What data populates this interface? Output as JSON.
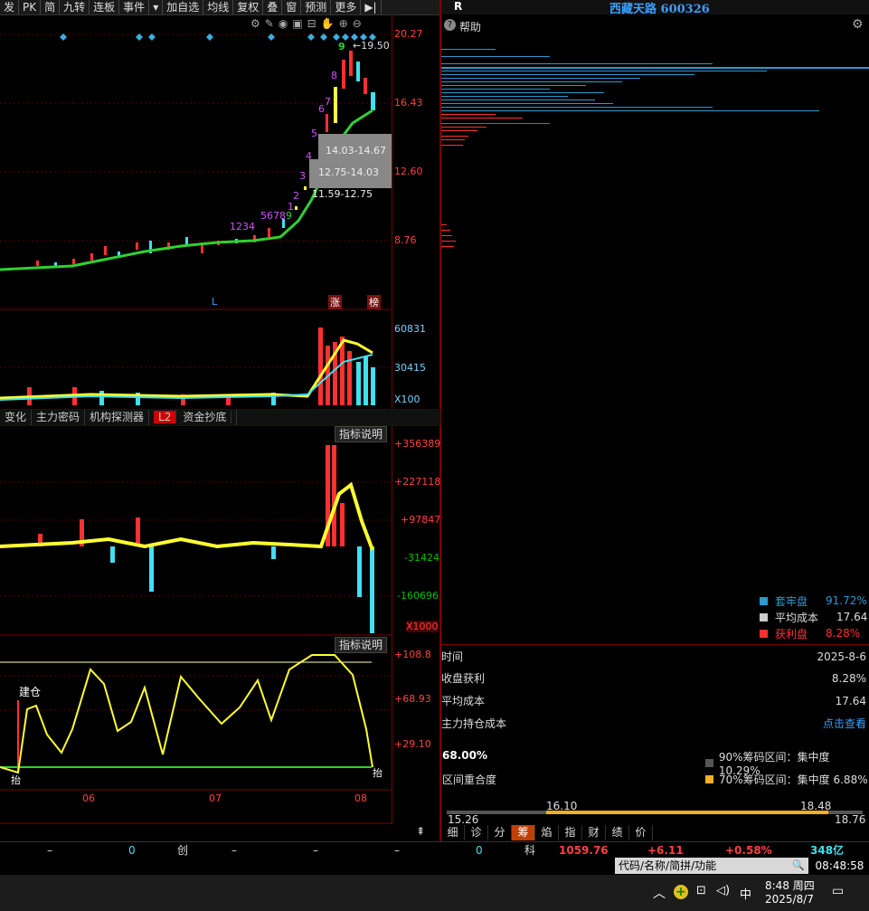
{
  "toolbar": {
    "items": [
      "发",
      "PK",
      "简",
      "九转",
      "连板",
      "事件",
      "▾",
      "加自选",
      "均线",
      "复权",
      "叠",
      "窗",
      "预测",
      "更多",
      "▶|"
    ]
  },
  "header": {
    "r_label": "R",
    "stock_name": "西藏天路 600326",
    "help": "帮助"
  },
  "price_axis": [
    "20.27",
    "16.43",
    "12.60",
    "8.76"
  ],
  "price_annotations": {
    "high": "19.50",
    "box1": "14.03-14.67",
    "box2": "12.75-14.03",
    "box3": "11.59-12.75",
    "zhang": "涨",
    "bang": "榜",
    "l_mark": "L"
  },
  "nine_turn": {
    "labels": [
      "1",
      "2",
      "3",
      "4",
      "5",
      "6",
      "7",
      "8",
      "9",
      "1",
      "2",
      "3",
      "4",
      "5",
      "6",
      "7",
      "8",
      "9"
    ]
  },
  "volume_axis": [
    "60831",
    "30415",
    "X100"
  ],
  "tabs": [
    "变化",
    "主力密码",
    "机构探测器",
    "L2",
    "资金抄底"
  ],
  "indicator1": {
    "desc_label": "指标说明",
    "axis": [
      "+356389",
      "+227118",
      "+97847",
      "-31424",
      "-160696",
      "X1000"
    ]
  },
  "indicator2": {
    "desc_label": "指标说明",
    "axis": [
      "+108.8",
      "+68.93",
      "+29.10"
    ],
    "build": "建仓",
    "di": "抬",
    "di2": "抬"
  },
  "x_axis": [
    "06",
    "07",
    "08"
  ],
  "chip": {
    "legend": [
      {
        "label": "套牢盘",
        "value": "91.72%",
        "color": "#2a9ad0"
      },
      {
        "label": "平均成本",
        "value": "17.64",
        "color": "#cccccc"
      },
      {
        "label": "获利盘",
        "value": "8.28%",
        "color": "#ff3030"
      }
    ],
    "rows": [
      {
        "label": "时间",
        "value": "2025-8-6"
      },
      {
        "label": "收盘获利",
        "value": "8.28%"
      },
      {
        "label": "平均成本",
        "value": "17.64"
      },
      {
        "label": "主力持仓成本",
        "value": "点击查看"
      }
    ],
    "overlap_pct": "68.00%",
    "overlap_label": "区间重合度",
    "c90": "90%筹码区间：集中度10.29%",
    "c70": "70%筹码区间：集中度 6.88%",
    "range_low": "15.26",
    "range_mid_low": "16.10",
    "range_mid_high": "18.48",
    "range_high": "18.76"
  },
  "bottom_tabs": [
    "细",
    "诊",
    "分",
    "筹",
    "焰",
    "指",
    "财",
    "绩",
    "价"
  ],
  "status": {
    "dash1": "–",
    "zero1": "0",
    "chuang": "创",
    "dash2": "–",
    "dash3": "–",
    "dash4": "–",
    "zero2": "0",
    "ke": "科",
    "index": "1059.76",
    "change": "+6.11",
    "pct": "+0.58%",
    "amount": "348亿"
  },
  "search": {
    "placeholder": "代码/名称/简拼/功能"
  },
  "clock": "08:48:58",
  "taskbar": {
    "ime": "中",
    "time": "8:48 周四",
    "date": "2025/8/7"
  }
}
